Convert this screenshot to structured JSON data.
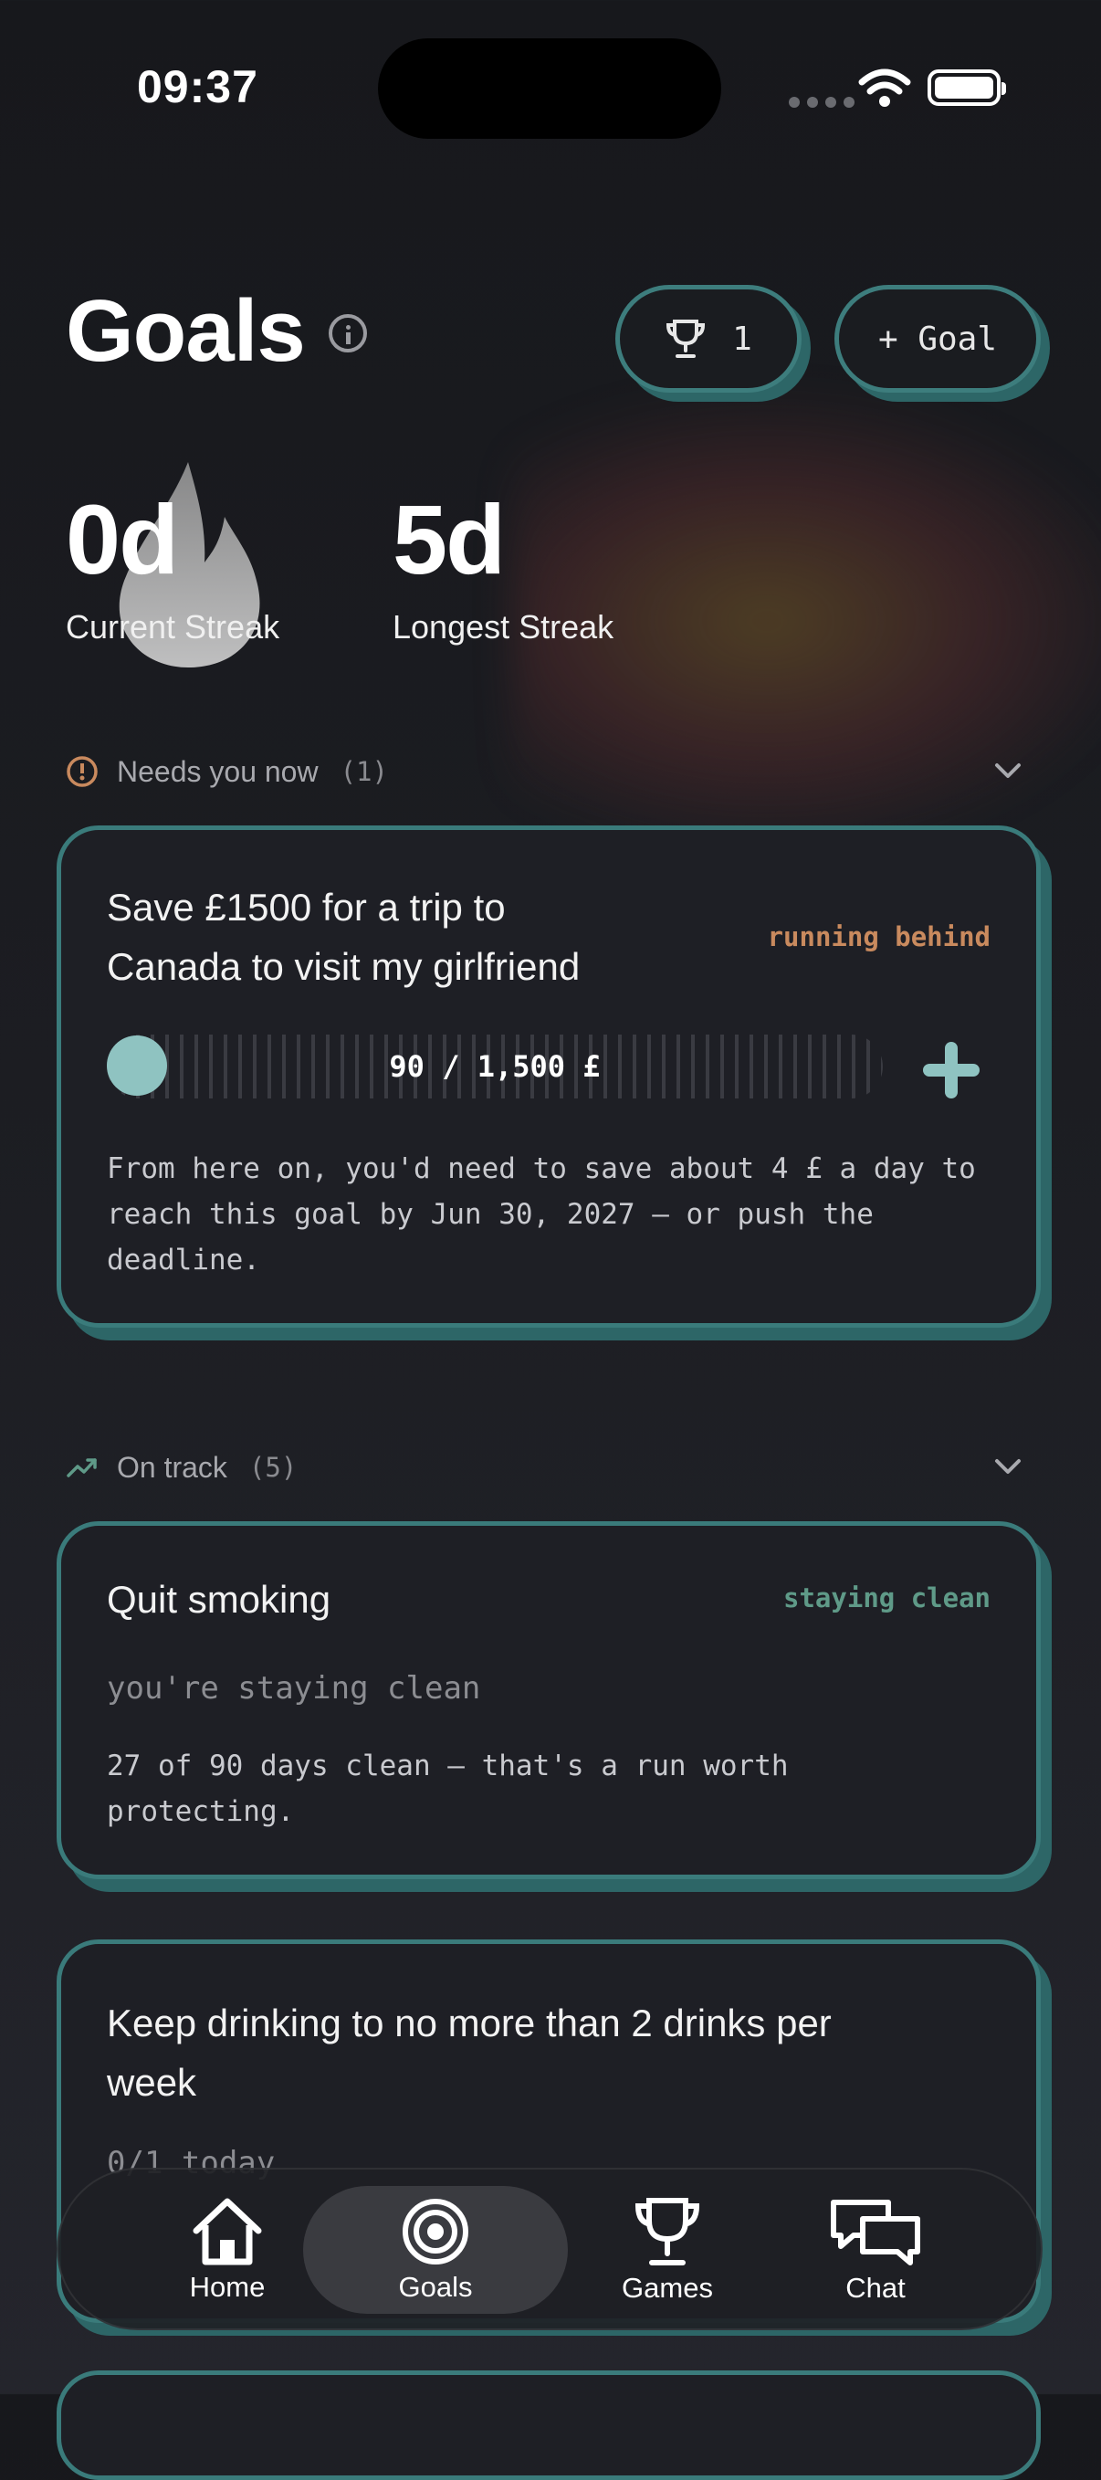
{
  "status_bar": {
    "time": "09:37"
  },
  "header": {
    "title": "Goals",
    "trophy_count": "1",
    "add_goal_label": "+ Goal"
  },
  "streaks": {
    "current": {
      "value": "0d",
      "label": "Current Streak"
    },
    "longest": {
      "value": "5d",
      "label": "Longest Streak"
    }
  },
  "sections": {
    "needs": {
      "title": "Needs you now",
      "count": "(1)"
    },
    "ontrack": {
      "title": "On track",
      "count": "(5)"
    }
  },
  "goals": [
    {
      "title_line1": "Save £1500 for a trip to",
      "title_line2": "Canada to visit my girlfriend",
      "tag": "running behind",
      "progress_text": "90 / 1,500 £",
      "progress_fraction": 0.06,
      "body_line1": "From here on, you'd need to save about 4 £ a day to",
      "body_line2": "reach this goal by Jun 30, 2027 — or push the",
      "body_line3": "deadline."
    },
    {
      "title_line1": "Quit smoking",
      "tag": "staying clean",
      "subtitle": "you're staying clean",
      "body_line1": "27 of 90 days clean — that's a run worth",
      "body_line2": "protecting."
    },
    {
      "title_line1": "Keep drinking to no more than 2 drinks per",
      "title_line2": "week",
      "subtitle": "0/1 today"
    }
  ],
  "tabs": [
    {
      "label": "Home",
      "icon": "home-icon"
    },
    {
      "label": "Goals",
      "icon": "target-icon"
    },
    {
      "label": "Games",
      "icon": "trophy-icon"
    },
    {
      "label": "Chat",
      "icon": "chat-icon"
    }
  ],
  "colors": {
    "accent_teal": "#3a7b7b",
    "tag_behind": "#c98a5e",
    "tag_clean": "#5f9a88",
    "knob": "#8fc3c1"
  }
}
